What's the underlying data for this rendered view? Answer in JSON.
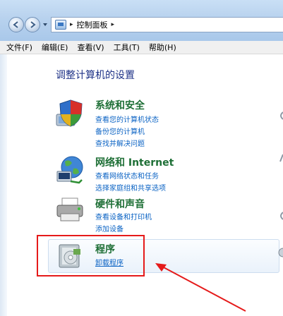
{
  "address": {
    "crumb": "控制面板",
    "separator": "▸"
  },
  "menu": [
    "文件(F)",
    "编辑(E)",
    "查看(V)",
    "工具(T)",
    "帮助(H)"
  ],
  "page_title": "调整计算机的设置",
  "categories": [
    {
      "title": "系统和安全",
      "links": [
        "查看您的计算机状态",
        "备份您的计算机",
        "查找并解决问题"
      ]
    },
    {
      "title": "网络和 Internet",
      "links": [
        "查看网络状态和任务",
        "选择家庭组和共享选项"
      ]
    },
    {
      "title": "硬件和声音",
      "links": [
        "查看设备和打印机",
        "添加设备"
      ]
    },
    {
      "title": "程序",
      "links": [
        "卸载程序"
      ]
    }
  ],
  "colors": {
    "link": "#0b63c4",
    "category": "#1e6f36",
    "page_title": "#1e3287",
    "annotation": "#e51a1a"
  }
}
